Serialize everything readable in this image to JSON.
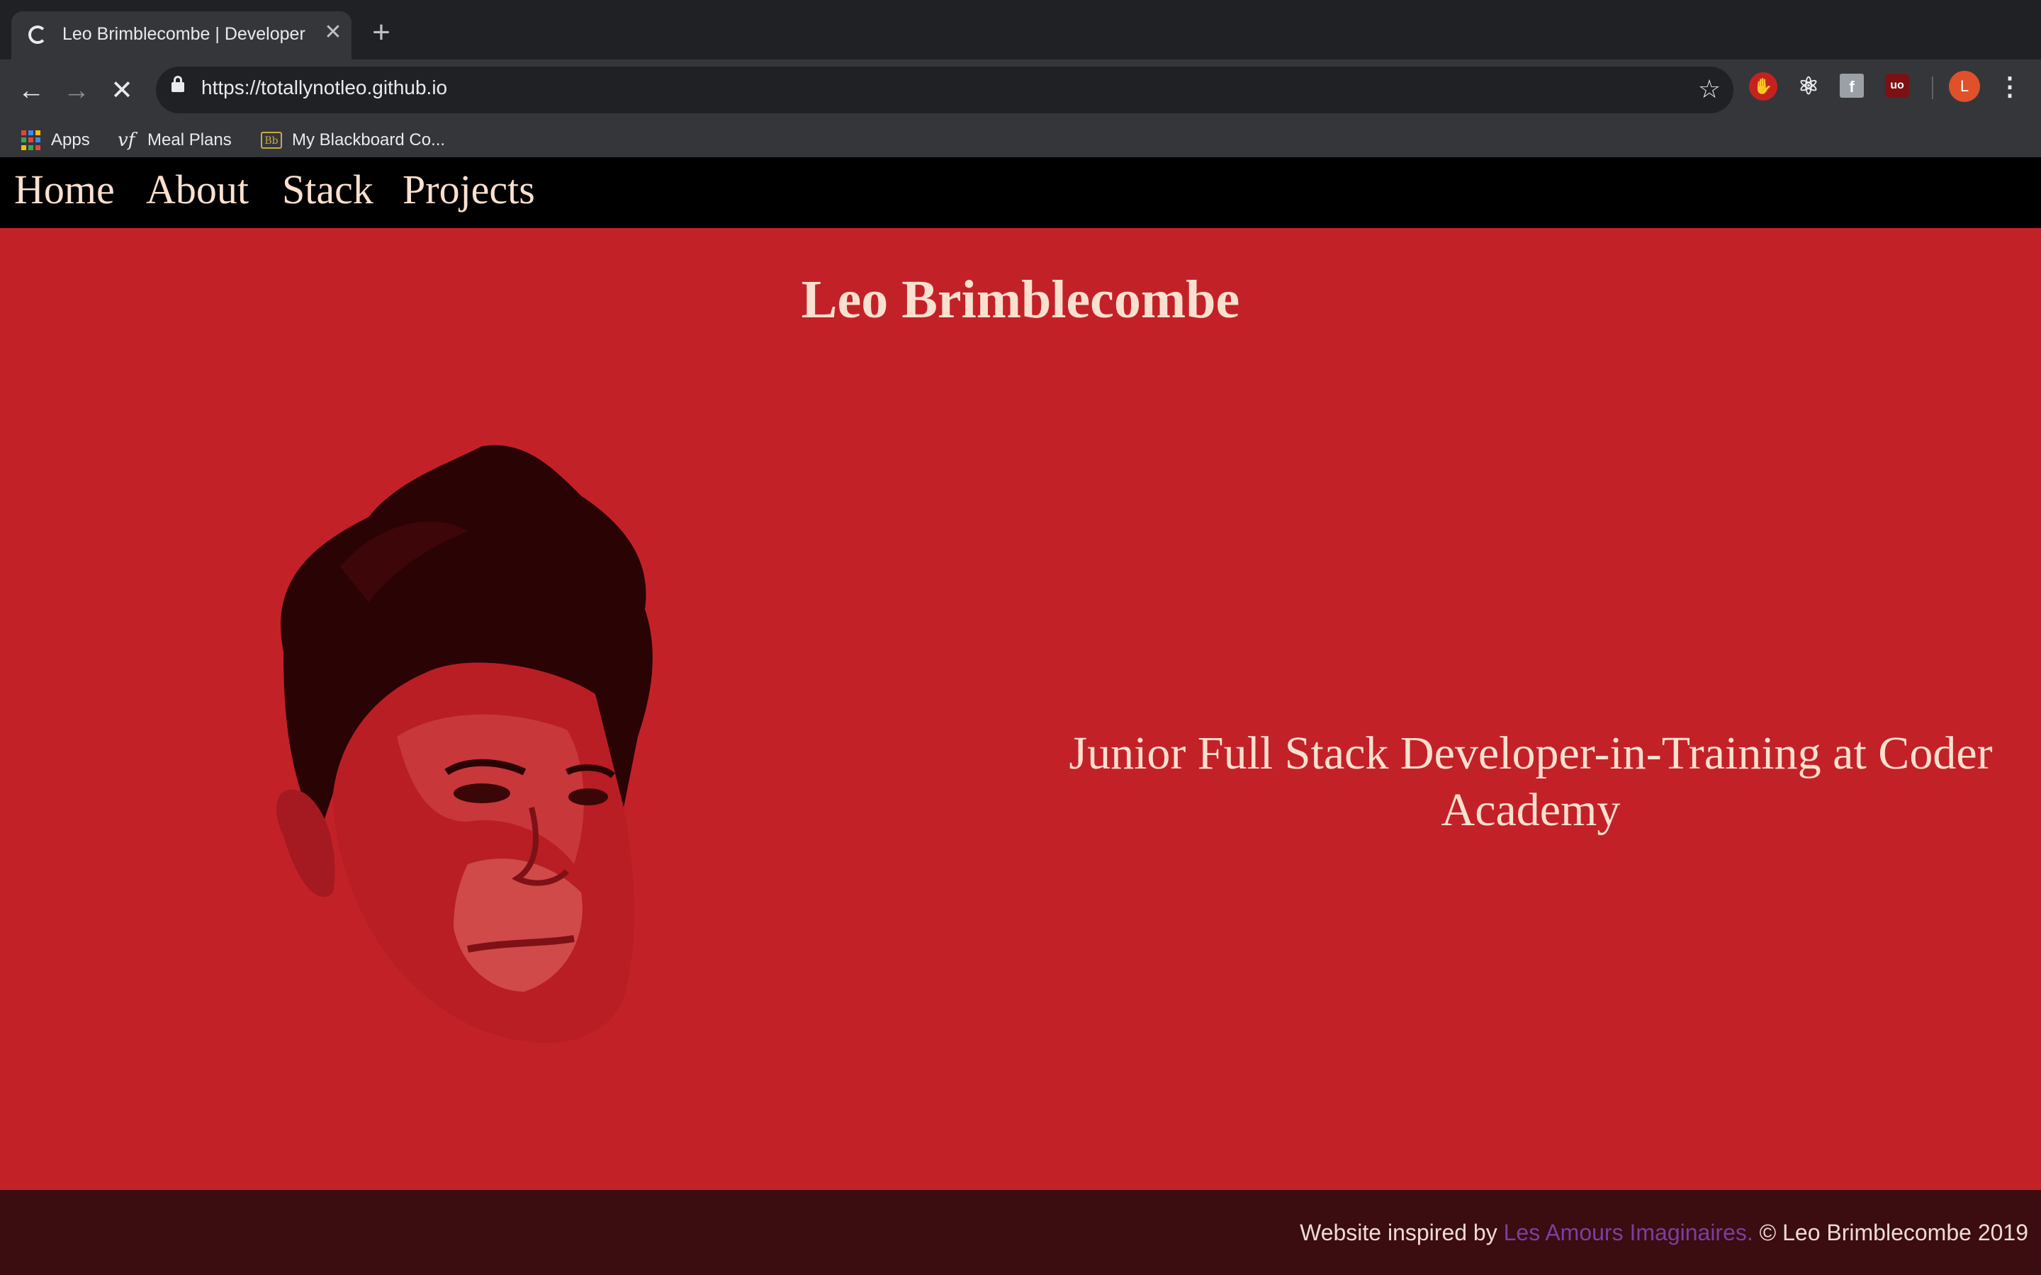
{
  "browser": {
    "tab_title": "Leo Brimblecombe | Developer",
    "new_tab_symbol": "+",
    "close_symbol": "✕",
    "url": "https://totallynotleo.github.io",
    "bookmarks": [
      {
        "label": "Apps",
        "icon": "apps-grid-icon"
      },
      {
        "label": "Meal Plans",
        "icon": "vf-icon"
      },
      {
        "label": "My Blackboard Co...",
        "icon": "blackboard-icon"
      }
    ],
    "profile_initial": "L",
    "vf_glyph": "vf",
    "bb_glyph": "Bb",
    "ext_icons": [
      "adblock-icon",
      "react-devtools-icon",
      "facebook-icon",
      "ublock-icon"
    ],
    "ext_glyphs": {
      "adblock": "✋",
      "react": "⚛",
      "facebook": "f",
      "ublock": "uo"
    }
  },
  "nav": {
    "items": [
      "Home",
      "About",
      "Stack",
      "Projects"
    ]
  },
  "hero": {
    "title": "Leo Brimblecombe",
    "tagline": "Junior Full Stack Developer-in-Training at Coder Academy"
  },
  "footer": {
    "prefix": "Website inspired by ",
    "link_text": "Les Amours Imaginaires.",
    "suffix": " © Leo Brimblecombe 2019"
  },
  "colors": {
    "background": "#c32128",
    "nav_bg": "#000000",
    "text": "#fae0cf",
    "footer_bg": "#3b0c10",
    "footer_link": "#7a3fa0"
  }
}
